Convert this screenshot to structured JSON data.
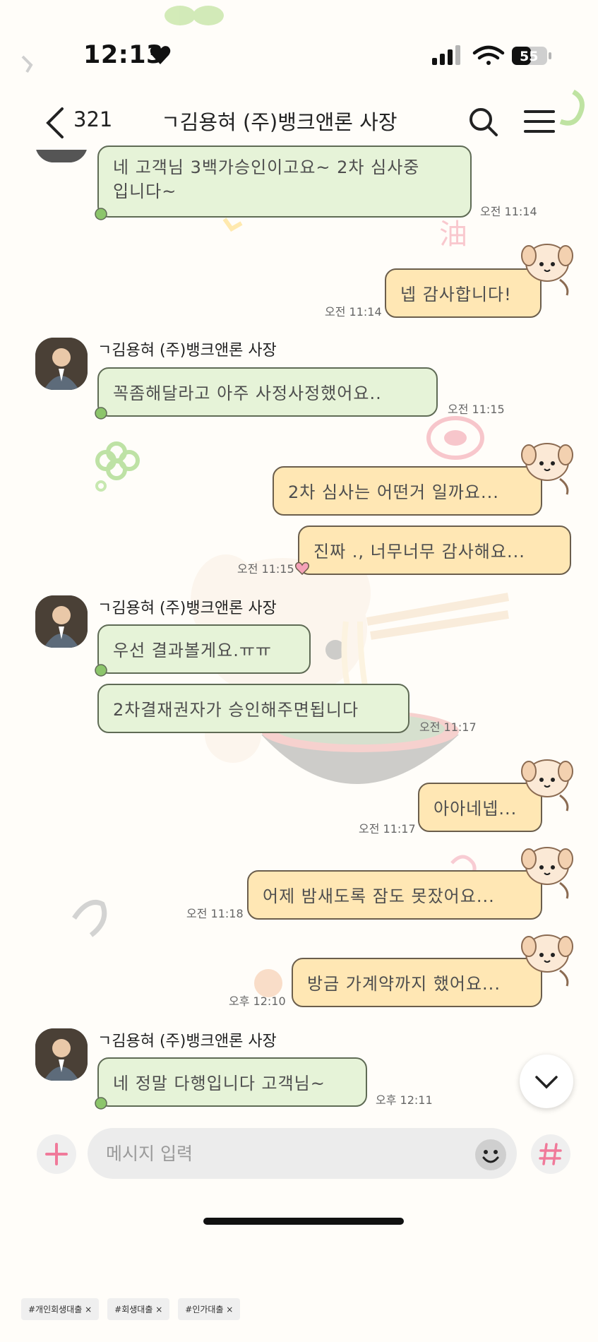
{
  "status_bar": {
    "time": "12:13",
    "battery": "55"
  },
  "header": {
    "count": "321",
    "title": "ㄱ김용혀 (주)뱅크앤론 사장"
  },
  "messages": [
    {
      "text_line1": "네 고객님 3백가승인이고요~ 2차 심사중",
      "text_line2": "입니다~",
      "time": "오전 11:14"
    },
    {
      "text": "넵 감사합니다!",
      "time": "오전 11:14"
    },
    {
      "sender": "ㄱ김용혀 (주)뱅크앤론 사장",
      "text": "꼭좀해달라고 아주 사정사정했어요..",
      "time": "오전 11:15"
    },
    {
      "text": "2차 심사는 어떤거 일까요...",
      "time": ""
    },
    {
      "text": "진짜 ., 너무너무 감사해요...",
      "time": "오전 11:15"
    },
    {
      "sender": "ㄱ김용혀 (주)뱅크앤론 사장",
      "text": "우선 결과볼게요.ㅠㅠ",
      "time": ""
    },
    {
      "text": "2차결재권자가 승인해주면됩니다",
      "time": "오전 11:17"
    },
    {
      "text": "아아네넵...",
      "time": "오전 11:17"
    },
    {
      "text": "어제 밤새도록 잠도 못잤어요...",
      "time": "오전 11:18"
    },
    {
      "text": "방금 가계약까지 했어요...",
      "time": "오후 12:10"
    },
    {
      "sender": "ㄱ김용혀 (주)뱅크앤론 사장",
      "text": "네 정말 다행입니다 고객님~",
      "time": "오후 12:11"
    }
  ],
  "input": {
    "placeholder": "메시지 입력"
  },
  "hashtags": [
    "#개인회생대출 ×",
    "#회생대출 ×",
    "#인가대출 ×"
  ],
  "colors": {
    "incoming_bubble": "#e6f3d8",
    "outgoing_bubble": "#ffe7b4",
    "accent_pink": "#f07a9a",
    "leaf_green": "#8cc56b"
  },
  "icons": [
    "back-icon",
    "search-icon",
    "menu-icon",
    "plus-icon",
    "emoji-icon",
    "hash-icon",
    "chevron-down-icon"
  ]
}
